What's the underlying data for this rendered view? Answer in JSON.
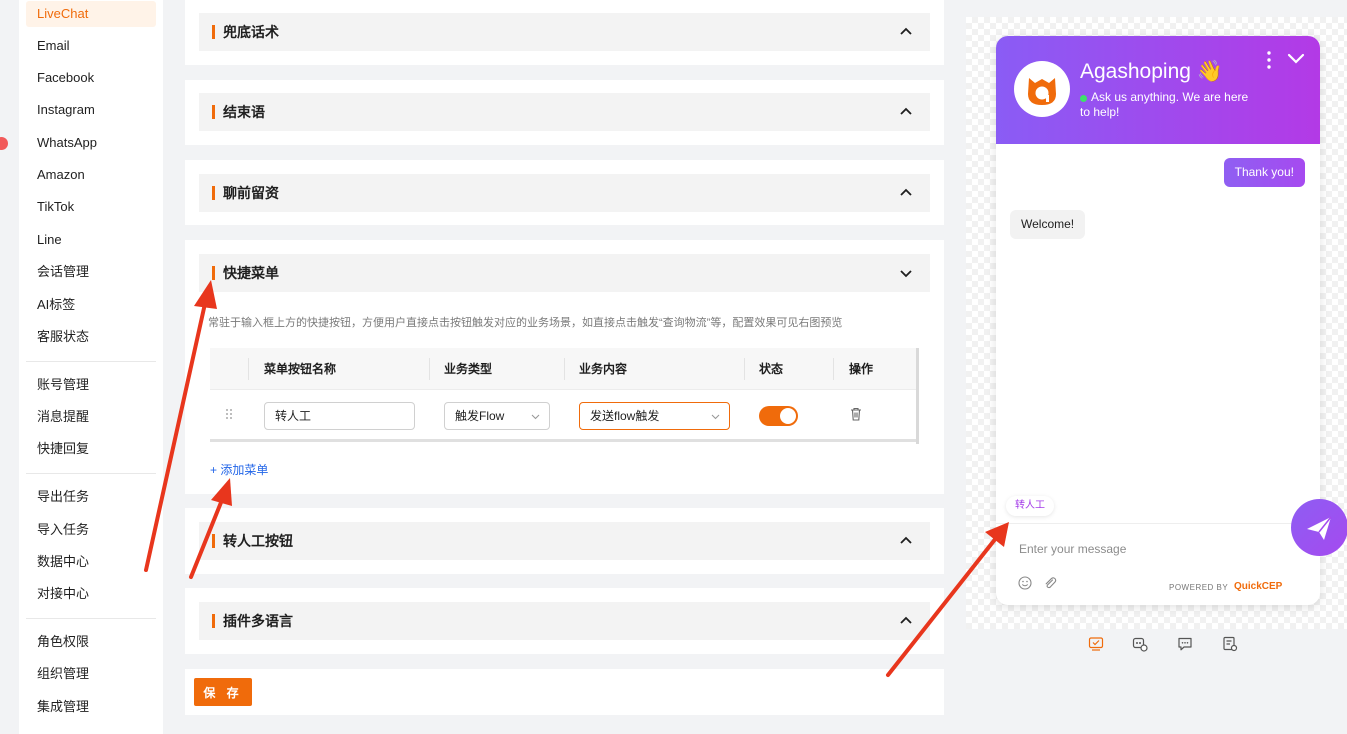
{
  "sidebar": {
    "groups": [
      [
        "LiveChat",
        "Email",
        "Facebook",
        "Instagram",
        "WhatsApp",
        "Amazon",
        "TikTok",
        "Line",
        "会话管理",
        "AI标签",
        "客服状态"
      ],
      [
        "账号管理",
        "消息提醒",
        "快捷回复"
      ],
      [
        "导出任务",
        "导入任务",
        "数据中心",
        "对接中心"
      ],
      [
        "角色权限",
        "组织管理",
        "集成管理"
      ]
    ],
    "active": "LiveChat"
  },
  "sections": {
    "fallback": "兜底话术",
    "closing": "结束语",
    "pre_chat": "聊前留资",
    "quick_menu": "快捷菜单",
    "transfer_button": "转人工按钮",
    "plugin_language": "插件多语言"
  },
  "quick_menu": {
    "description": "常驻于输入框上方的快捷按钮，方便用户直接点击按钮触发对应的业务场景，如直接点击触发“查询物流”等，配置效果可见右图预览",
    "columns": [
      "菜单按钮名称",
      "业务类型",
      "业务内容",
      "状态",
      "操作"
    ],
    "rows": [
      {
        "name": "转人工",
        "type": "触发Flow",
        "content": "发送flow触发",
        "enabled": true
      }
    ],
    "add_label": "+ 添加菜单"
  },
  "save_label": "保 存",
  "preview": {
    "brand": "Agashoping",
    "wave": "👋",
    "tagline": "Ask us anything. We are here to help!",
    "outgoing": "Thank you!",
    "incoming": "Welcome!",
    "quick_chip": "转人工",
    "input_placeholder": "Enter your message",
    "powered_by": "POWERED BY",
    "powered_brand": "QuickCEP"
  },
  "colors": {
    "accent": "#f06b0b",
    "chat_purple": "#a64af0",
    "link_blue": "#2366e8",
    "arrow_red": "#e8361d"
  }
}
